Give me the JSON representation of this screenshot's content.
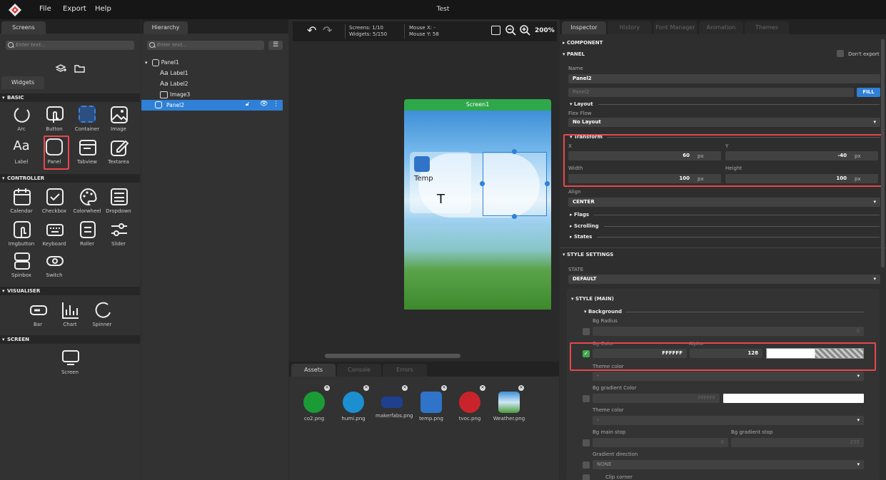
{
  "menubar": {
    "items": [
      "File",
      "Export",
      "Help"
    ],
    "title": "Test"
  },
  "screens_panel": {
    "tab": "Screens",
    "search_placeholder": "Enter text...",
    "widgets_tab": "Widgets"
  },
  "sections": [
    "BASIC",
    "CONTROLLER",
    "VISUALISER",
    "SCREEN"
  ],
  "basic": [
    "Arc",
    "Button",
    "Container",
    "Image",
    "Label",
    "Panel",
    "Tabview",
    "Textarea"
  ],
  "controller": [
    "Calendar",
    "Checkbox",
    "Colorwheel",
    "Dropdown",
    "Imgbutton",
    "Keyboard",
    "Roller",
    "Slider",
    "Spinbox",
    "Switch"
  ],
  "visualiser": [
    "Bar",
    "Chart",
    "Spinner"
  ],
  "screen": [
    "Screen"
  ],
  "hierarchy": {
    "tab": "Hierarchy",
    "search_placeholder": "Enter text...",
    "items": [
      "Panel1",
      "Label1",
      "Label2",
      "Image3",
      "Panel2"
    ]
  },
  "toolbar": {
    "screens": "Screens: 1/10",
    "widgets": "Widgets: 5/150",
    "mouse_x": "Mouse X: -",
    "mouse_y": "Mouse Y: 58",
    "zoom": "200%"
  },
  "canvas": {
    "screen_name": "Screen1",
    "temp_label": "Temp",
    "t_label": "T"
  },
  "bottom": {
    "tabs": [
      "Assets",
      "Console",
      "Errors"
    ],
    "assets": [
      "co2.png",
      "humi.png",
      "makerfabs.png",
      "temp.png",
      "tvoc.png",
      "Weather.png"
    ]
  },
  "inspector": {
    "tabs": [
      "Inspector",
      "History",
      "Font Manager",
      "Animation",
      "Themes"
    ],
    "component": "COMPONENT",
    "panel": "PANEL",
    "dont_export": "Don't export",
    "name_label": "Name",
    "name_value": "Panel2",
    "name_placeholder": "Panel2",
    "fill": "FILL",
    "layout": "Layout",
    "flex_flow": "Flex Flow",
    "flex_value": "No Layout",
    "transform": "Transform",
    "x_label": "X",
    "x_value": "60",
    "y_label": "Y",
    "y_value": "-40",
    "width_label": "Width",
    "width_value": "100",
    "height_label": "Height",
    "height_value": "100",
    "unit": "px",
    "align_label": "Align",
    "align_value": "CENTER",
    "flags": "Flags",
    "scrolling": "Scrolling",
    "states": "States",
    "style_settings": "STYLE SETTINGS",
    "state_label": "STATE",
    "state_value": "DEFAULT",
    "style_main": "STYLE (MAIN)",
    "background": "Background",
    "bg_radius": "Bg Radius",
    "bg_radius_value": "0",
    "bg_color": "Bg Color",
    "bg_color_value": "FFFFFF",
    "alpha_label": "Alpha",
    "alpha_value": "128",
    "theme_color": "Theme color",
    "theme_value": "-",
    "bg_grad": "Bg gradient Color",
    "bg_grad_value": "FFFFFF",
    "theme_color2": "Theme color",
    "theme_value2": "-",
    "bg_main_stop": "Bg main stop",
    "bg_main_stop_value": "0",
    "bg_grad_stop": "Bg gradient stop",
    "bg_grad_stop_value": "255",
    "grad_dir": "Gradient direction",
    "grad_dir_value": "NONE",
    "clip_corner": "Clip corner"
  },
  "colors": {
    "accent": "#2f80d6",
    "screen_header": "#2ea84a",
    "highlight": "#e8474c"
  }
}
